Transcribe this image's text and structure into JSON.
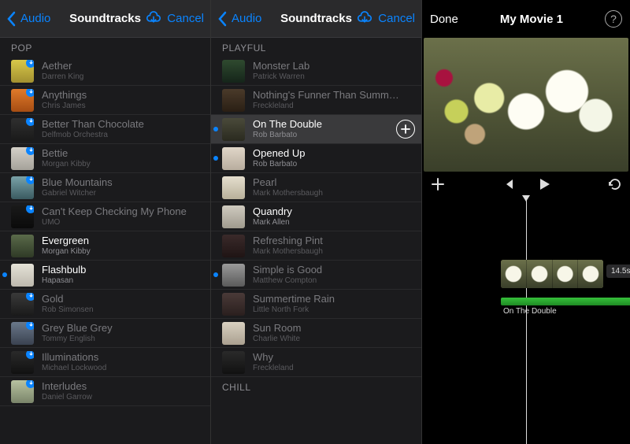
{
  "accent": "#0a84ff",
  "paneA": {
    "back": "Audio",
    "title": "Soundtracks",
    "cancel": "Cancel",
    "section": "POP",
    "tracks": [
      {
        "title": "Aether",
        "artist": "Darren King",
        "thumb": "linear-gradient(#d8c84a,#a29030)",
        "cloud": true,
        "dim": true
      },
      {
        "title": "Anythings",
        "artist": "Chris James",
        "thumb": "linear-gradient(#e07a2a,#a64d13)",
        "cloud": true,
        "dim": true
      },
      {
        "title": "Better Than Chocolate",
        "artist": "Delfmob Orchestra",
        "thumb": "linear-gradient(#2f2f2f,#1a1a1a)",
        "cloud": true,
        "dim": true
      },
      {
        "title": "Bettie",
        "artist": "Morgan Kibby",
        "thumb": "linear-gradient(#d4d0c8,#a5a29a)",
        "cloud": true,
        "dim": true
      },
      {
        "title": "Blue Mountains",
        "artist": "Gabriel Witcher",
        "thumb": "linear-gradient(#7aa2a8,#3a5a60)",
        "cloud": true,
        "dim": true
      },
      {
        "title": "Can't Keep Checking My Phone",
        "artist": "UMO",
        "thumb": "linear-gradient(#1a1a1a,#0a0a0a)",
        "cloud": true,
        "dim": true
      },
      {
        "title": "Evergreen",
        "artist": "Morgan Kibby",
        "thumb": "linear-gradient(#5a6a4a,#2f3a26)",
        "cloud": false,
        "dim": false,
        "downloaded": true
      },
      {
        "title": "Flashbulb",
        "artist": "Hapasan",
        "thumb": "linear-gradient(#e5e2d8,#bdb9ad)",
        "cloud": false,
        "dim": false,
        "downloaded": true,
        "dot": true
      },
      {
        "title": "Gold",
        "artist": "Rob Simonsen",
        "thumb": "linear-gradient(#3a3a3a,#1a1a1a)",
        "cloud": true,
        "dim": true
      },
      {
        "title": "Grey Blue Grey",
        "artist": "Tommy English",
        "thumb": "linear-gradient(#6a788a,#3a4250)",
        "cloud": true,
        "dim": true
      },
      {
        "title": "Illuminations",
        "artist": "Michael Lockwood",
        "thumb": "linear-gradient(#2a2a2a,#111)",
        "cloud": true,
        "dim": true
      },
      {
        "title": "Interludes",
        "artist": "Daniel Garrow",
        "thumb": "linear-gradient(#b8c2a0,#7a856a)",
        "cloud": true,
        "dim": true
      }
    ]
  },
  "paneB": {
    "back": "Audio",
    "title": "Soundtracks",
    "cancel": "Cancel",
    "sections": [
      {
        "header": "PLAYFUL",
        "tracks": [
          {
            "title": "Monster Lab",
            "artist": "Patrick Warren",
            "thumb": "linear-gradient(#2f4a2f,#15251a)",
            "dim": true
          },
          {
            "title": "Nothing's Funner Than Summ…",
            "artist": "Freckleland",
            "thumb": "linear-gradient(#4a3a2a,#2a1f14)",
            "dim": true
          },
          {
            "title": "On The Double",
            "artist": "Rob Barbato",
            "thumb": "linear-gradient(#4a4a3a,#2a2a1f)",
            "dim": false,
            "selected": true,
            "add": true,
            "dot": true
          },
          {
            "title": "Opened Up",
            "artist": "Rob Barbato",
            "thumb": "linear-gradient(#e0d6c8,#b8ad9e)",
            "dim": false,
            "dot": true
          },
          {
            "title": "Pearl",
            "artist": "Mark Mothersbaugh",
            "thumb": "linear-gradient(#e5dfce,#b8b09a)",
            "dim": true
          },
          {
            "title": "Quandry",
            "artist": "Mark Allen",
            "thumb": "linear-gradient(#cfcabf,#9f9a8e)",
            "dim": false
          },
          {
            "title": "Refreshing Pint",
            "artist": "Mark Mothersbaugh",
            "thumb": "linear-gradient(#3a2a2a,#1f1414)",
            "dim": true
          },
          {
            "title": "Simple is Good",
            "artist": "Matthew Compton",
            "thumb": "linear-gradient(#9a9a9a,#5a5a5a)",
            "dim": true,
            "dot": true
          },
          {
            "title": "Summertime Rain",
            "artist": "Little North Fork",
            "thumb": "linear-gradient(#4a3a38,#2a1f1e)",
            "dim": true
          },
          {
            "title": "Sun Room",
            "artist": "Charlie White",
            "thumb": "linear-gradient(#d8d0c0,#aaa090)",
            "dim": true
          },
          {
            "title": "Why",
            "artist": "Freckleland",
            "thumb": "linear-gradient(#2a2a2a,#111)",
            "dim": true
          }
        ]
      },
      {
        "header": "CHILL",
        "tracks": []
      }
    ]
  },
  "paneC": {
    "done": "Done",
    "title": "My Movie 1",
    "clip_duration": "14.5s",
    "audio_clip_label": "On The Double"
  }
}
